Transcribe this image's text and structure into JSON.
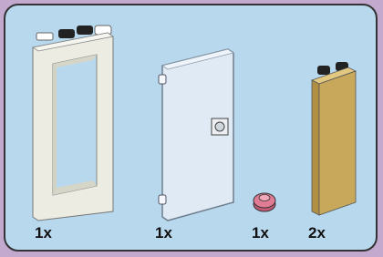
{
  "pieces": [
    {
      "icon": "window-frame-icon",
      "quantity": "1x"
    },
    {
      "icon": "door-icon",
      "quantity": "1x"
    },
    {
      "icon": "round-plate-icon",
      "quantity": "1x"
    },
    {
      "icon": "tan-brick-icon",
      "quantity": "2x"
    }
  ],
  "colors": {
    "page_background": "#c4a9cf",
    "panel_background": "#b8d8ee",
    "panel_border": "#333333",
    "frame_white": "#ecece2",
    "door_pane": "#dfeaf4",
    "plate_pink": "#e07c94",
    "brick_tan": "#c8a85a"
  }
}
